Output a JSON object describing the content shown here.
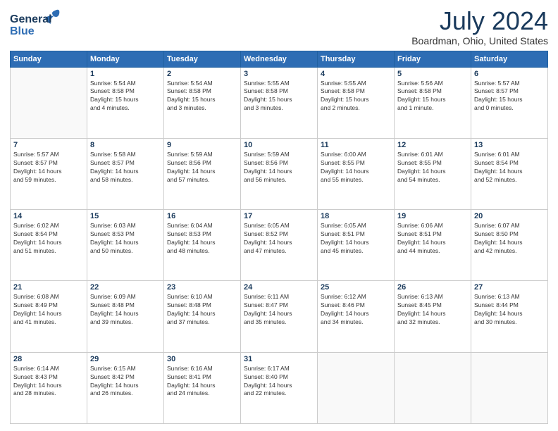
{
  "header": {
    "logo_general": "General",
    "logo_blue": "Blue",
    "title": "July 2024",
    "subtitle": "Boardman, Ohio, United States"
  },
  "calendar": {
    "headers": [
      "Sunday",
      "Monday",
      "Tuesday",
      "Wednesday",
      "Thursday",
      "Friday",
      "Saturday"
    ],
    "weeks": [
      [
        {
          "day": "",
          "detail": ""
        },
        {
          "day": "1",
          "detail": "Sunrise: 5:54 AM\nSunset: 8:58 PM\nDaylight: 15 hours\nand 4 minutes."
        },
        {
          "day": "2",
          "detail": "Sunrise: 5:54 AM\nSunset: 8:58 PM\nDaylight: 15 hours\nand 3 minutes."
        },
        {
          "day": "3",
          "detail": "Sunrise: 5:55 AM\nSunset: 8:58 PM\nDaylight: 15 hours\nand 3 minutes."
        },
        {
          "day": "4",
          "detail": "Sunrise: 5:55 AM\nSunset: 8:58 PM\nDaylight: 15 hours\nand 2 minutes."
        },
        {
          "day": "5",
          "detail": "Sunrise: 5:56 AM\nSunset: 8:58 PM\nDaylight: 15 hours\nand 1 minute."
        },
        {
          "day": "6",
          "detail": "Sunrise: 5:57 AM\nSunset: 8:57 PM\nDaylight: 15 hours\nand 0 minutes."
        }
      ],
      [
        {
          "day": "7",
          "detail": "Sunrise: 5:57 AM\nSunset: 8:57 PM\nDaylight: 14 hours\nand 59 minutes."
        },
        {
          "day": "8",
          "detail": "Sunrise: 5:58 AM\nSunset: 8:57 PM\nDaylight: 14 hours\nand 58 minutes."
        },
        {
          "day": "9",
          "detail": "Sunrise: 5:59 AM\nSunset: 8:56 PM\nDaylight: 14 hours\nand 57 minutes."
        },
        {
          "day": "10",
          "detail": "Sunrise: 5:59 AM\nSunset: 8:56 PM\nDaylight: 14 hours\nand 56 minutes."
        },
        {
          "day": "11",
          "detail": "Sunrise: 6:00 AM\nSunset: 8:55 PM\nDaylight: 14 hours\nand 55 minutes."
        },
        {
          "day": "12",
          "detail": "Sunrise: 6:01 AM\nSunset: 8:55 PM\nDaylight: 14 hours\nand 54 minutes."
        },
        {
          "day": "13",
          "detail": "Sunrise: 6:01 AM\nSunset: 8:54 PM\nDaylight: 14 hours\nand 52 minutes."
        }
      ],
      [
        {
          "day": "14",
          "detail": "Sunrise: 6:02 AM\nSunset: 8:54 PM\nDaylight: 14 hours\nand 51 minutes."
        },
        {
          "day": "15",
          "detail": "Sunrise: 6:03 AM\nSunset: 8:53 PM\nDaylight: 14 hours\nand 50 minutes."
        },
        {
          "day": "16",
          "detail": "Sunrise: 6:04 AM\nSunset: 8:53 PM\nDaylight: 14 hours\nand 48 minutes."
        },
        {
          "day": "17",
          "detail": "Sunrise: 6:05 AM\nSunset: 8:52 PM\nDaylight: 14 hours\nand 47 minutes."
        },
        {
          "day": "18",
          "detail": "Sunrise: 6:05 AM\nSunset: 8:51 PM\nDaylight: 14 hours\nand 45 minutes."
        },
        {
          "day": "19",
          "detail": "Sunrise: 6:06 AM\nSunset: 8:51 PM\nDaylight: 14 hours\nand 44 minutes."
        },
        {
          "day": "20",
          "detail": "Sunrise: 6:07 AM\nSunset: 8:50 PM\nDaylight: 14 hours\nand 42 minutes."
        }
      ],
      [
        {
          "day": "21",
          "detail": "Sunrise: 6:08 AM\nSunset: 8:49 PM\nDaylight: 14 hours\nand 41 minutes."
        },
        {
          "day": "22",
          "detail": "Sunrise: 6:09 AM\nSunset: 8:48 PM\nDaylight: 14 hours\nand 39 minutes."
        },
        {
          "day": "23",
          "detail": "Sunrise: 6:10 AM\nSunset: 8:48 PM\nDaylight: 14 hours\nand 37 minutes."
        },
        {
          "day": "24",
          "detail": "Sunrise: 6:11 AM\nSunset: 8:47 PM\nDaylight: 14 hours\nand 35 minutes."
        },
        {
          "day": "25",
          "detail": "Sunrise: 6:12 AM\nSunset: 8:46 PM\nDaylight: 14 hours\nand 34 minutes."
        },
        {
          "day": "26",
          "detail": "Sunrise: 6:13 AM\nSunset: 8:45 PM\nDaylight: 14 hours\nand 32 minutes."
        },
        {
          "day": "27",
          "detail": "Sunrise: 6:13 AM\nSunset: 8:44 PM\nDaylight: 14 hours\nand 30 minutes."
        }
      ],
      [
        {
          "day": "28",
          "detail": "Sunrise: 6:14 AM\nSunset: 8:43 PM\nDaylight: 14 hours\nand 28 minutes."
        },
        {
          "day": "29",
          "detail": "Sunrise: 6:15 AM\nSunset: 8:42 PM\nDaylight: 14 hours\nand 26 minutes."
        },
        {
          "day": "30",
          "detail": "Sunrise: 6:16 AM\nSunset: 8:41 PM\nDaylight: 14 hours\nand 24 minutes."
        },
        {
          "day": "31",
          "detail": "Sunrise: 6:17 AM\nSunset: 8:40 PM\nDaylight: 14 hours\nand 22 minutes."
        },
        {
          "day": "",
          "detail": ""
        },
        {
          "day": "",
          "detail": ""
        },
        {
          "day": "",
          "detail": ""
        }
      ]
    ]
  }
}
